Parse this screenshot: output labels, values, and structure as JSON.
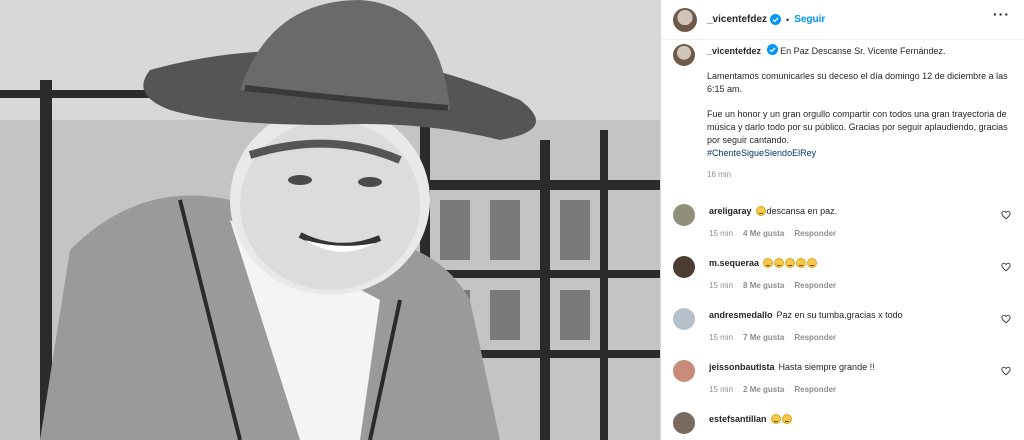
{
  "post": {
    "username": "_vicentefdez",
    "separator": "•",
    "follow_label": "Seguir",
    "more_label": "···"
  },
  "caption": {
    "username": "_vicentefdez",
    "line1": "En Paz Descanse Sr. Vicente Fernández.",
    "para2": "Lamentamos comunicarles su deceso el día domingo 12 de diciembre a las 6:15 am.",
    "para3": "Fue un honor y un gran orgullo compartir con todos una gran trayectoria de música y darlo todo por su público. Gracias por seguir aplaudiendo, gracias por seguir cantando.",
    "hashtag": "#ChenteSigueSiendoElRey",
    "time": "16 min"
  },
  "comments": [
    {
      "user": "areligaray",
      "text": "descansa en paz.",
      "emojis": 1,
      "time": "15 min",
      "likes": "4 Me gusta",
      "reply": "Responder",
      "avatar_color": "#8f8f7a"
    },
    {
      "user": "m.sequeraa",
      "text": "",
      "emojis": 5,
      "time": "15 min",
      "likes": "8 Me gusta",
      "reply": "Responder",
      "avatar_color": "#4a3b33"
    },
    {
      "user": "andresmedallo",
      "text": "Paz en su tumba,gracias x todo",
      "emojis": 0,
      "time": "15 min",
      "likes": "7 Me gusta",
      "reply": "Responder",
      "avatar_color": "#b6c0c8"
    },
    {
      "user": "jeissonbautista",
      "text": "Hasta siempre grande !!",
      "emojis": 0,
      "time": "15 min",
      "likes": "2 Me gusta",
      "reply": "Responder",
      "avatar_color": "#c98c7a"
    },
    {
      "user": "estefsantillan",
      "text": "",
      "emojis": 2,
      "time": "",
      "likes": "",
      "reply": "",
      "avatar_color": "#7a6a5e"
    }
  ],
  "colors": {
    "link_blue": "#0095f6",
    "hashtag_blue": "#00376b",
    "meta_gray": "#8e8e8e"
  },
  "icons": [
    "verified-badge-icon",
    "more-options-icon",
    "heart-icon",
    "crying-face-emoji"
  ]
}
